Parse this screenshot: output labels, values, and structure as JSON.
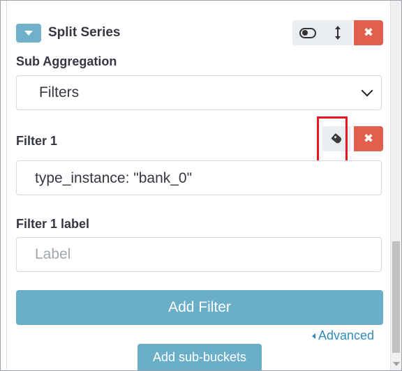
{
  "split_series": {
    "title": "Split Series"
  },
  "sub_aggregation": {
    "label": "Sub Aggregation",
    "selected": "Filters"
  },
  "filter1": {
    "label": "Filter 1",
    "query": "type_instance: \"bank_0\""
  },
  "filter1_label": {
    "label": "Filter 1 label",
    "placeholder": "Label"
  },
  "buttons": {
    "add_filter": "Add Filter",
    "advanced": "Advanced",
    "add_sub_buckets": "Add sub-buckets"
  },
  "colors": {
    "accent": "#6aaec7",
    "danger": "#e05f4d",
    "highlight": "#e8151e",
    "link": "#2f8bbd"
  },
  "icons": [
    "chevron-down-icon",
    "toggle-icon",
    "up-down-arrow-icon",
    "close-icon",
    "tag-icon",
    "select-chevron-icon",
    "caret-left-icon"
  ]
}
